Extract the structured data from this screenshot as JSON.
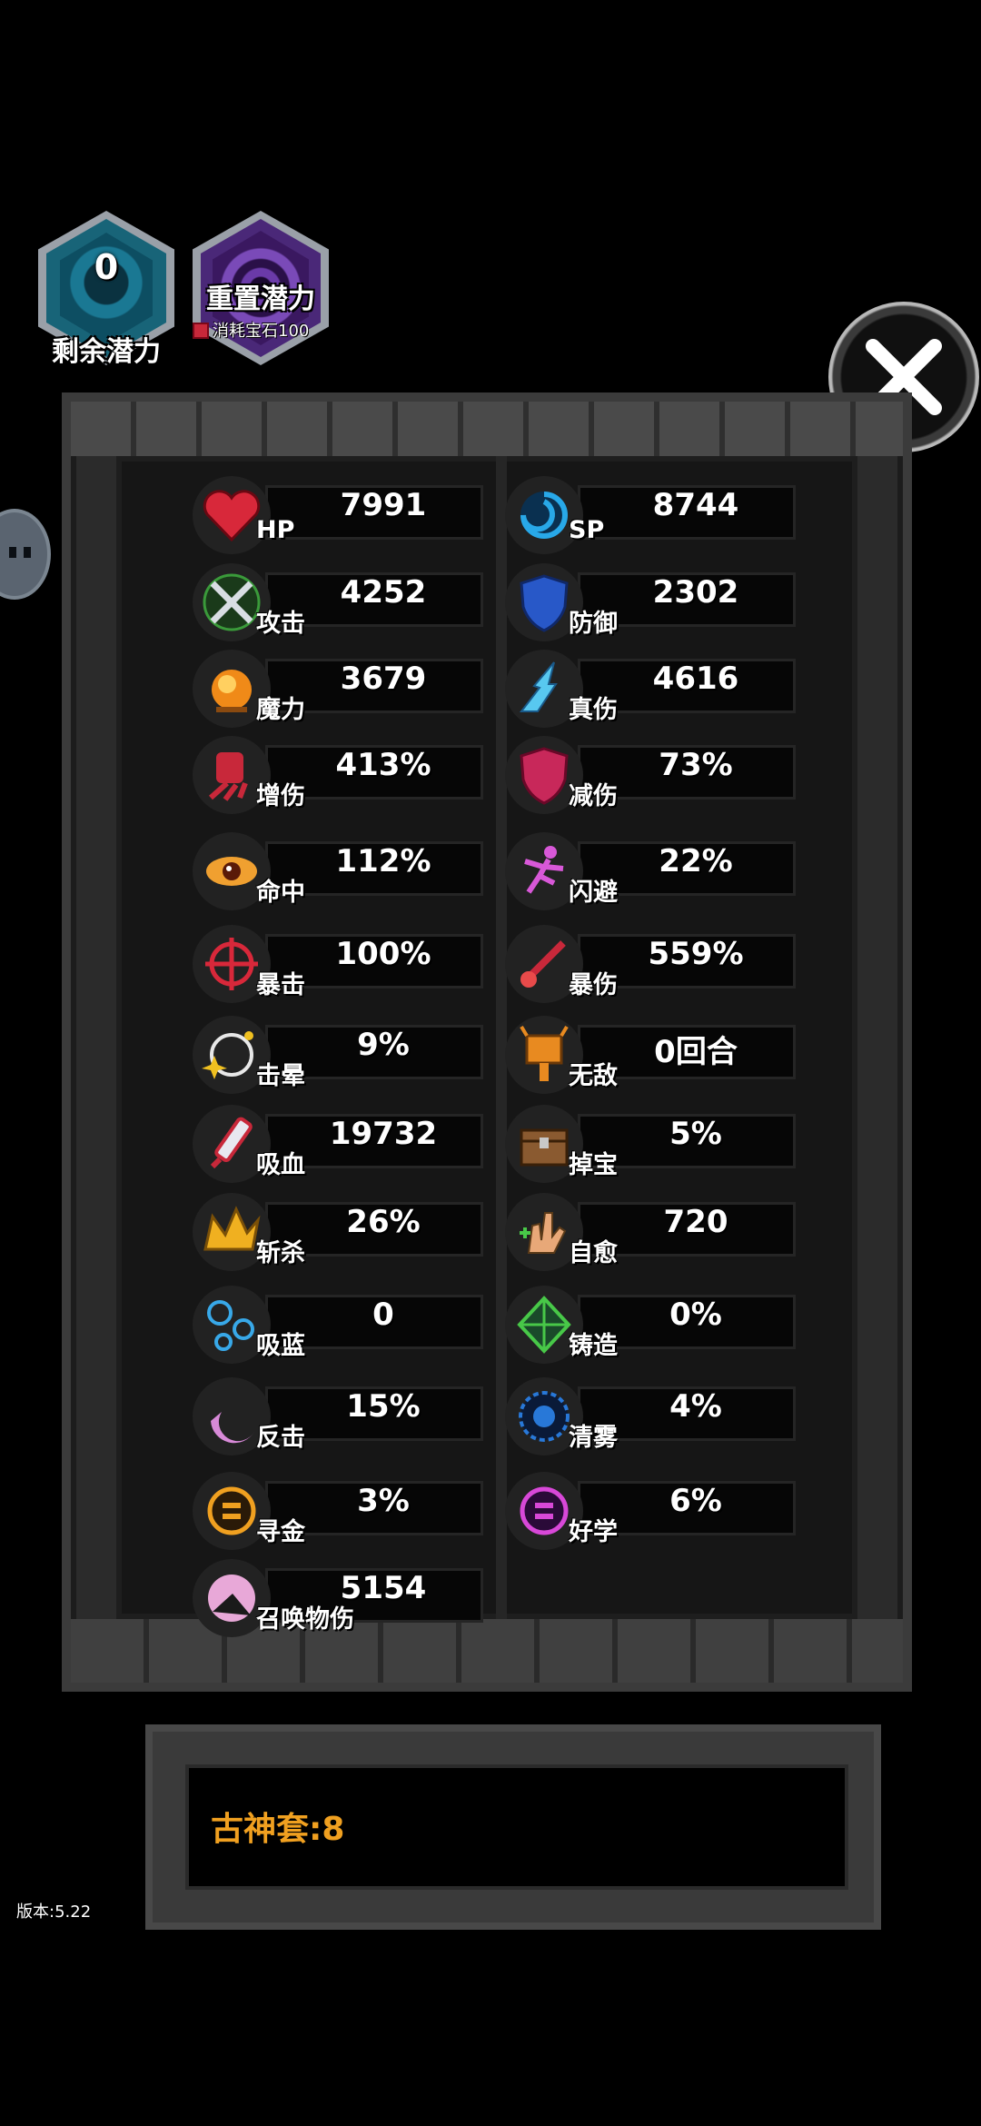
{
  "potential": {
    "remaining_value": "0",
    "remaining_label": "剩余潜力"
  },
  "reset": {
    "label": "重置潜力",
    "cost_text": "消耗宝石100"
  },
  "stats_left": [
    {
      "label": "HP",
      "value": "7991",
      "icon": "heart-icon"
    },
    {
      "label": "攻击",
      "value": "4252",
      "icon": "crossed-swords-icon"
    },
    {
      "label": "魔力",
      "value": "3679",
      "icon": "magic-orb-icon"
    },
    {
      "label": "增伤",
      "value": "413%",
      "icon": "fist-icon"
    },
    {
      "label": "命中",
      "value": "112%",
      "icon": "eye-icon"
    },
    {
      "label": "暴击",
      "value": "100%",
      "icon": "crosshair-icon"
    },
    {
      "label": "击晕",
      "value": "9%",
      "icon": "stun-stars-icon"
    },
    {
      "label": "吸血",
      "value": "19732",
      "icon": "blood-syringe-icon"
    },
    {
      "label": "斩杀",
      "value": "26%",
      "icon": "execute-crown-icon"
    },
    {
      "label": "吸蓝",
      "value": "0",
      "icon": "mana-bubbles-icon"
    },
    {
      "label": "反击",
      "value": "15%",
      "icon": "counter-crescent-icon"
    },
    {
      "label": "寻金",
      "value": "3%",
      "icon": "gold-coin-icon"
    },
    {
      "label": "召唤物伤",
      "value": "5154",
      "icon": "summon-icon"
    }
  ],
  "stats_right": [
    {
      "label": "SP",
      "value": "8744",
      "icon": "vortex-icon"
    },
    {
      "label": "防御",
      "value": "2302",
      "icon": "blue-shield-icon"
    },
    {
      "label": "真伤",
      "value": "4616",
      "icon": "ice-spike-icon"
    },
    {
      "label": "减伤",
      "value": "73%",
      "icon": "red-shield-icon"
    },
    {
      "label": "闪避",
      "value": "22%",
      "icon": "dodge-runner-icon"
    },
    {
      "label": "暴伤",
      "value": "559%",
      "icon": "crit-sword-icon"
    },
    {
      "label": "无敌",
      "value": "0回合",
      "icon": "invincible-totem-icon"
    },
    {
      "label": "掉宝",
      "value": "5%",
      "icon": "treasure-chest-icon"
    },
    {
      "label": "自愈",
      "value": "720",
      "icon": "healing-hand-icon"
    },
    {
      "label": "铸造",
      "value": "0%",
      "icon": "forge-gem-icon"
    },
    {
      "label": "清雾",
      "value": "4%",
      "icon": "fog-clear-icon"
    },
    {
      "label": "好学",
      "value": "6%",
      "icon": "study-coin-icon"
    }
  ],
  "set_bonus": "古神套:8",
  "version": "版本:5.22",
  "colors": {
    "accent_orange": "#f0a020",
    "background": "#000000"
  }
}
